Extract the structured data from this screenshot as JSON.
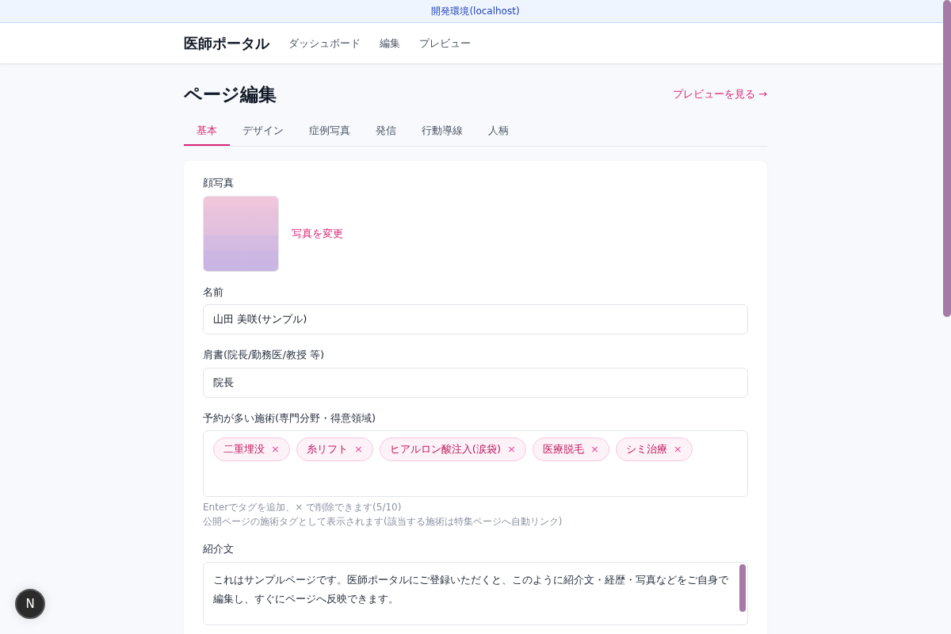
{
  "env_banner": "開発環境(localhost)",
  "navbar": {
    "brand": "医師ポータル",
    "links": [
      {
        "label": "ダッシュボード",
        "selected": false
      },
      {
        "label": "編集",
        "selected": false
      },
      {
        "label": "プレビュー",
        "selected": false
      }
    ]
  },
  "page": {
    "title": "ページ編集",
    "preview_link": "プレビューを見る →"
  },
  "tabs": [
    {
      "label": "基本",
      "selected": true
    },
    {
      "label": "デザイン",
      "selected": false
    },
    {
      "label": "症例写真",
      "selected": false
    },
    {
      "label": "発信",
      "selected": false
    },
    {
      "label": "行動導線",
      "selected": false
    },
    {
      "label": "人柄",
      "selected": false
    }
  ],
  "form": {
    "photo": {
      "label": "顔写真",
      "change_link": "写真を変更"
    },
    "name": {
      "label": "名前",
      "value": "山田 美咲(サンプル)"
    },
    "position": {
      "label": "肩書(院長/勤務医/教授 等)",
      "value": "院長"
    },
    "treatments": {
      "label": "予約が多い施術(専門分野・得意領域)",
      "tags": [
        {
          "label": "二重埋没",
          "remove": "×"
        },
        {
          "label": "糸リフト",
          "remove": "×"
        },
        {
          "label": "ヒアルロン酸注入(涙袋)",
          "remove": "×"
        },
        {
          "label": "医療脱毛",
          "remove": "×"
        },
        {
          "label": "シミ治療",
          "remove": "×"
        }
      ],
      "hints": [
        "Enterでタグを追加、× で削除できます(5/10)",
        "公開ページの施術タグとして表示されます(該当する施術は特集ページへ自動リンク)"
      ]
    },
    "intro": {
      "label": "紹介文",
      "value": "これはサンプルページです。医師ポータルにご登録いただくと、このように紹介文・経歴・写真などをご自身で編集し、すぐにページへ反映できます。"
    }
  },
  "dev_badge": "N"
}
